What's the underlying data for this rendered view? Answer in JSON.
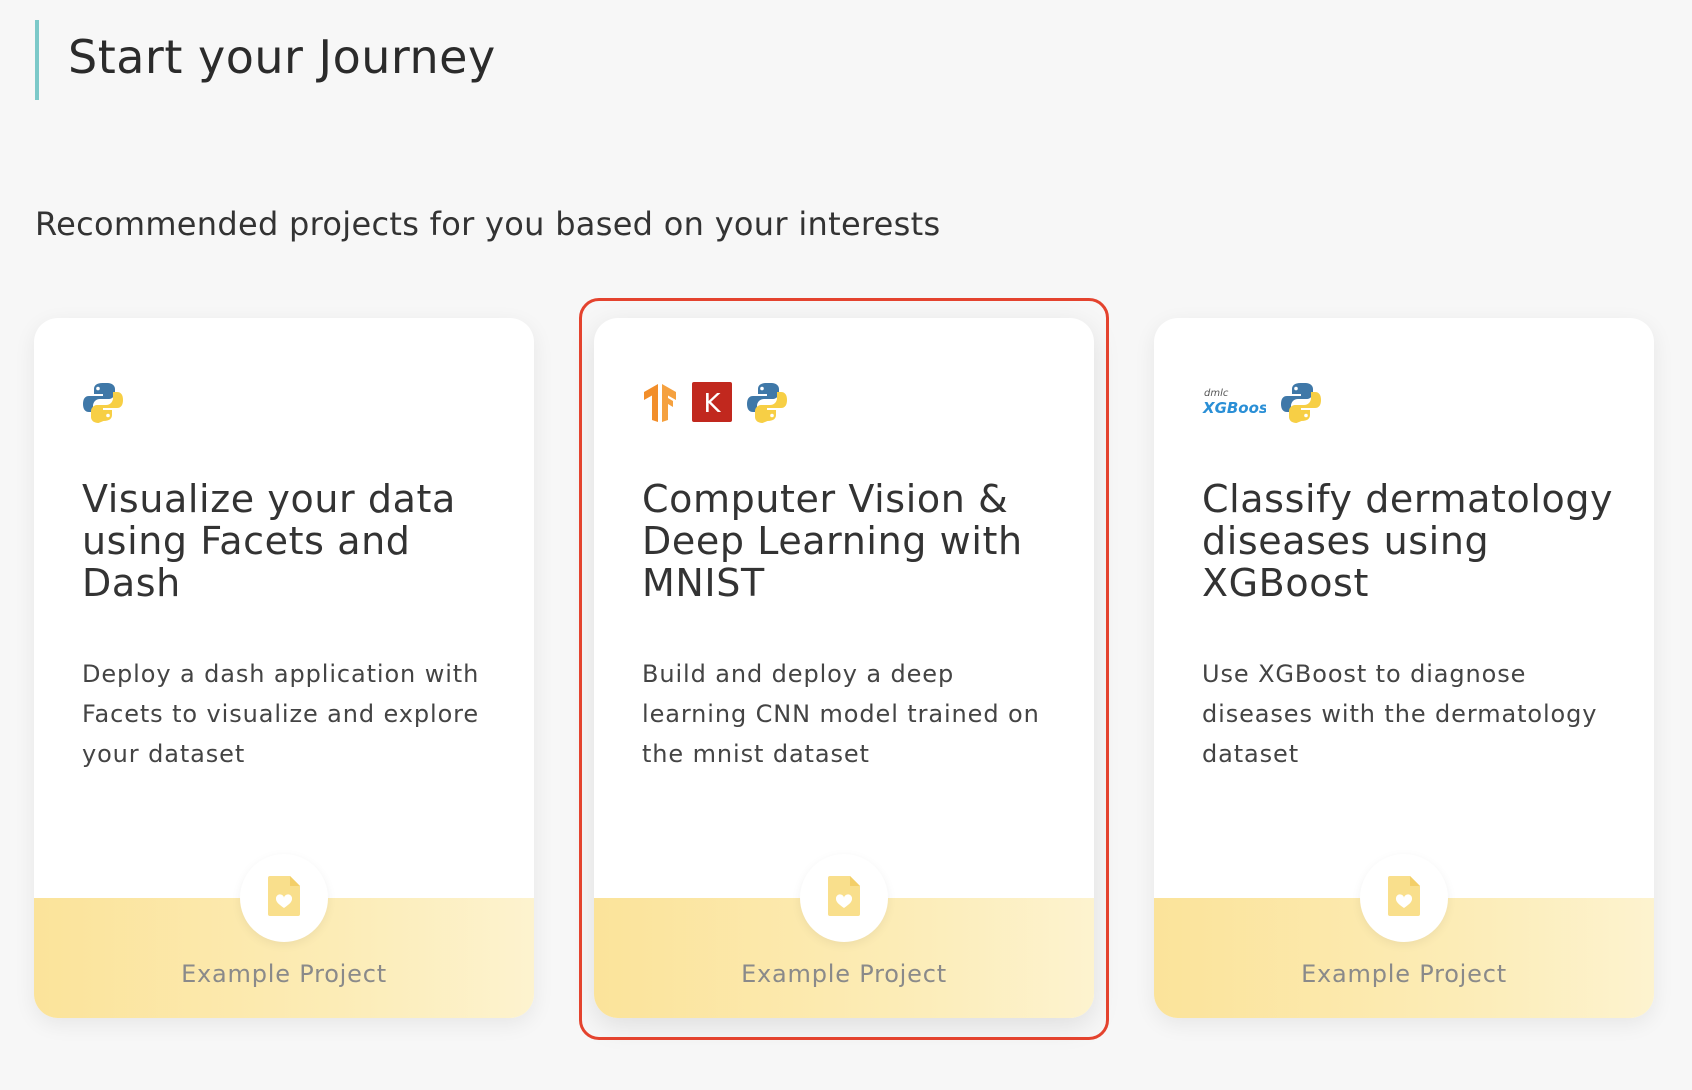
{
  "header": {
    "title": "Start your Journey",
    "subtitle": "Recommended projects for you based on your interests"
  },
  "cards": [
    {
      "icons": [
        "python-icon"
      ],
      "title": "Visualize your data using Facets and Dash",
      "description": "Deploy a dash application with Facets to visualize and explore your dataset",
      "footer_label": "Example Project"
    },
    {
      "icons": [
        "tensorflow-icon",
        "keras-icon",
        "python-icon"
      ],
      "title": "Computer Vision & Deep Learning with MNIST",
      "description": "Build and deploy a deep learning CNN model trained on the mnist dataset",
      "footer_label": "Example Project",
      "highlighted": true,
      "keras_letter": "K"
    },
    {
      "icons": [
        "xgboost-logo",
        "python-icon"
      ],
      "title": "Classify dermatology diseases using XGBoost",
      "description": "Use XGBoost to diagnose diseases with the dermatology dataset",
      "footer_label": "Example Project",
      "xgboost_logo_small": "dmlc",
      "xgboost_logo_text": "XGBoost"
    }
  ],
  "colors": {
    "accent_bar": "#7cc9c9",
    "highlight_border": "#e4432e",
    "footer_yellow": "#fbe39a",
    "file_icon_yellow": "#f9df8c"
  }
}
